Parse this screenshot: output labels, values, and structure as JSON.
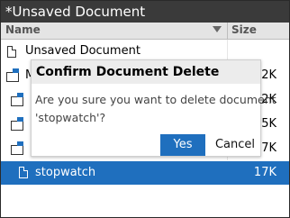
{
  "window": {
    "title": "*Unsaved Document"
  },
  "columns": {
    "name": "Name",
    "size": "Size"
  },
  "rows": [
    {
      "label": "Unsaved Document",
      "size": "",
      "type": "document"
    },
    {
      "label": "M",
      "size": "2K",
      "type": "folder"
    },
    {
      "label": "",
      "size": "2K",
      "type": "document-shortcut"
    },
    {
      "label": "",
      "size": "5K",
      "type": "document-shortcut"
    },
    {
      "label": "",
      "size": "7K",
      "type": "document-shortcut"
    },
    {
      "label": "stopwatch",
      "size": "17K",
      "type": "document",
      "selected": true
    }
  ],
  "dialog": {
    "title": "Confirm Document Delete",
    "message_line1": "Are you sure you want to delete document",
    "message_line2": "'stopwatch'?",
    "yes_label": "Yes",
    "cancel_label": "Cancel"
  },
  "colors": {
    "accent": "#1f6fbe",
    "titlebar": "#3a3a3a",
    "header": "#e4e4e4",
    "dialog_title": "#ececec"
  },
  "icons": {
    "sort": "triangle-down-icon",
    "document": "document-icon",
    "folder": "folder-icon"
  }
}
